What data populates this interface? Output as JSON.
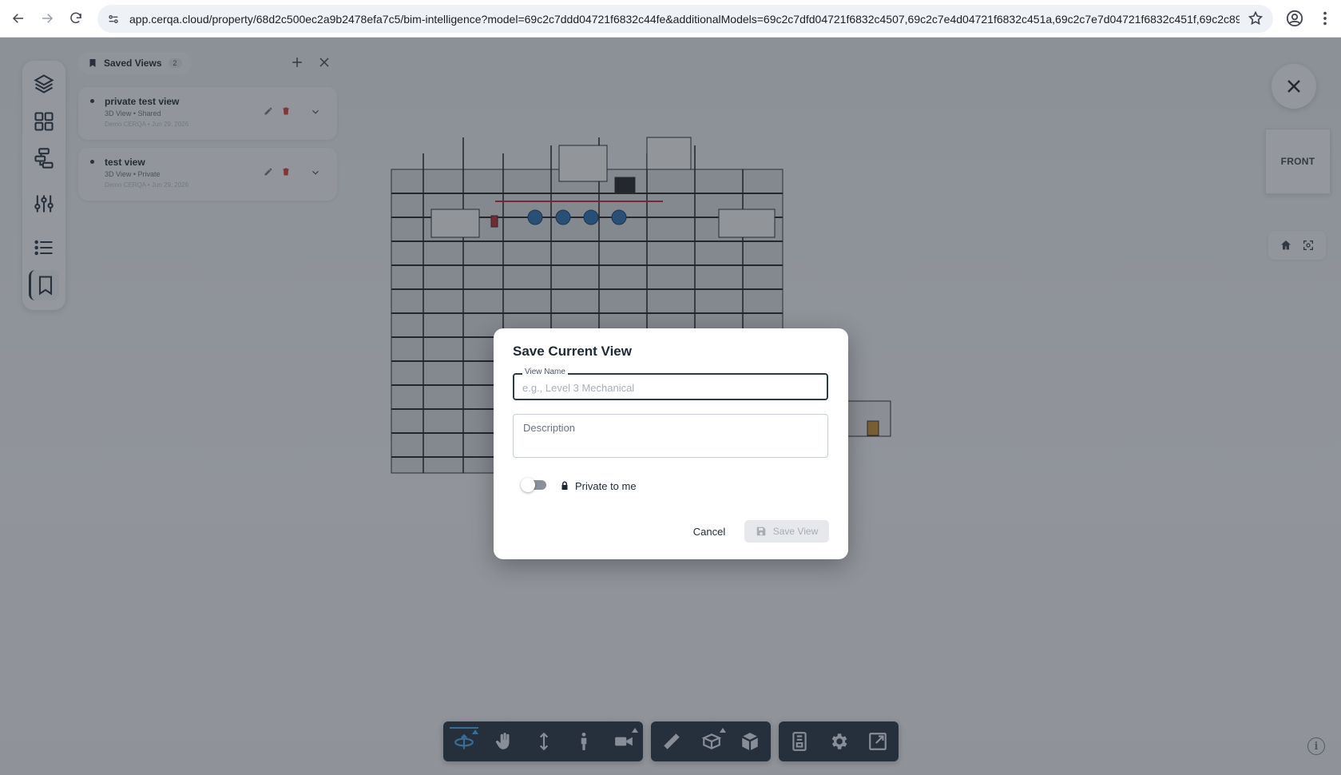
{
  "browser": {
    "url": "app.cerqa.cloud/property/68d2c500ec2a9b2478efa7c5/bim-intelligence?model=69c2c7ddd04721f6832c44fe&additionalModels=69c2c7dfd04721f6832c4507,69c2c7e4d04721f6832c451a,69c2c7e7d04721f6832c451f,69c2c89..."
  },
  "saved_views_panel": {
    "title": "Saved Views",
    "count": "2",
    "views": [
      {
        "name": "private test view",
        "meta": "3D View • Shared",
        "sub": "Demo CERQA • Jun 29, 2026"
      },
      {
        "name": "test view",
        "meta": "3D View • Private",
        "sub": "Demo CERQA • Jun 29, 2026"
      }
    ]
  },
  "viewcube": {
    "label": "FRONT"
  },
  "modal": {
    "title": "Save Current View",
    "view_name_label": "View Name",
    "view_name_placeholder": "e.g., Level 3 Mechanical",
    "description_placeholder": "Description",
    "private_label": "Private to me",
    "private_enabled": false,
    "cancel_label": "Cancel",
    "save_label": "Save View"
  },
  "info_button": {
    "label": "i"
  },
  "colors": {
    "toolbar_bg": "#263040",
    "accent": "#4aa8e8",
    "modal_border_focus": "#2b3a50",
    "delete": "#d43a3a"
  },
  "icons": {
    "left_rail": [
      "layers-icon",
      "grid-icon",
      "hierarchy-icon",
      "sliders-icon",
      "list-icon",
      "bookmark-icon"
    ],
    "toolbar": [
      "orbit-icon",
      "pan-hand-icon",
      "vertical-move-icon",
      "walk-person-icon",
      "camera-icon",
      "ruler-icon",
      "section-box-icon",
      "explode-cube-icon",
      "properties-icon",
      "settings-icon",
      "fullscreen-icon"
    ]
  }
}
